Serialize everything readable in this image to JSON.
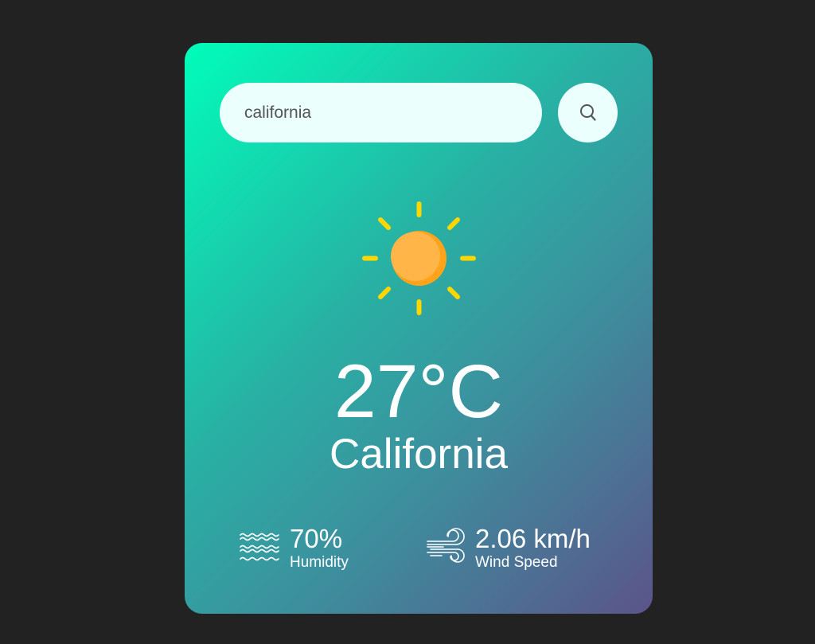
{
  "search": {
    "value": "california",
    "icon": "search-icon"
  },
  "weather": {
    "icon": "sun-icon",
    "temperature": "27°C",
    "city": "California",
    "sun_color": "#ffa726",
    "ray_color": "#ffd600"
  },
  "details": {
    "humidity": {
      "value": "70%",
      "label": "Humidity",
      "icon": "humidity-icon"
    },
    "wind": {
      "value": "2.06 km/h",
      "label": "Wind Speed",
      "icon": "wind-icon"
    }
  },
  "colors": {
    "background": "#222222",
    "gradient_start": "#00feba",
    "gradient_end": "#5b548a",
    "input_bg": "#ebfffc"
  }
}
